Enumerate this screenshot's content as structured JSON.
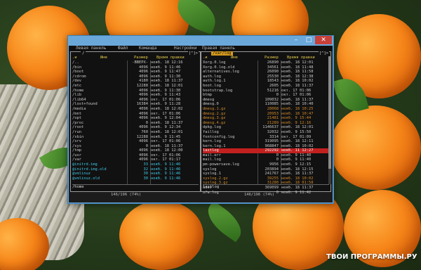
{
  "window": {
    "controls": {
      "minimize": "–",
      "maximize": "□",
      "close": "✕"
    }
  },
  "menubar": {
    "items": [
      "Левая панель",
      "Файл",
      "Команда",
      "Настройки",
      "Правая панель"
    ]
  },
  "left_panel": {
    "path": "/",
    "controls": "[^]>",
    "headers": {
      "name": "Имя",
      "size": "Размер",
      "time": "Время правки"
    },
    "rows": [
      {
        "name": "/..",
        "size": "-ВВЕРХ-",
        "time": "нояб. 18 12:16",
        "type": "dir"
      },
      {
        "name": "/bin",
        "size": "4096",
        "time": "нояб. 9 11:46",
        "type": "dir"
      },
      {
        "name": "/boot",
        "size": "4096",
        "time": "нояб. 9 11:47",
        "type": "dir"
      },
      {
        "name": "/cdrom",
        "size": "4096",
        "time": "нояб. 9 11:30",
        "type": "dir"
      },
      {
        "name": "/dev",
        "size": "4180",
        "time": "нояб. 18 11:37",
        "type": "dir"
      },
      {
        "name": "/etc",
        "size": "12288",
        "time": "нояб. 18 12:01",
        "type": "dir"
      },
      {
        "name": "/home",
        "size": "4096",
        "time": "нояб. 9 11:30",
        "type": "dir"
      },
      {
        "name": "/lib",
        "size": "4096",
        "time": "нояб. 9 11:43",
        "type": "dir"
      },
      {
        "name": "/lib64",
        "size": "4096",
        "time": "окт. 17 01:06",
        "type": "dir"
      },
      {
        "name": "/lost+found",
        "size": "16384",
        "time": "нояб. 9 11:28",
        "type": "dir"
      },
      {
        "name": "/media",
        "size": "4096",
        "time": "нояб. 18 12:02",
        "type": "dir"
      },
      {
        "name": "/mnt",
        "size": "4096",
        "time": "окт. 17 01:06",
        "type": "dir"
      },
      {
        "name": "/opt",
        "size": "4096",
        "time": "нояб. 9 12:04",
        "type": "dir"
      },
      {
        "name": "/proc",
        "size": "0",
        "time": "нояб. 18 11:37",
        "type": "dir"
      },
      {
        "name": "/root",
        "size": "4096",
        "time": "нояб. 9 12:34",
        "type": "dir"
      },
      {
        "name": "/run",
        "size": "760",
        "time": "нояб. 18 12:01",
        "type": "dir"
      },
      {
        "name": "/sbin",
        "size": "12288",
        "time": "нояб. 9 11:45",
        "type": "dir"
      },
      {
        "name": "/srv",
        "size": "4096",
        "time": "окт. 17 01:06",
        "type": "dir"
      },
      {
        "name": "/sys",
        "size": "0",
        "time": "нояб. 18 11:37",
        "type": "dir"
      },
      {
        "name": "/tmp",
        "size": "4096",
        "time": "нояб. 18 12:00",
        "type": "dir"
      },
      {
        "name": "/usr",
        "size": "4096",
        "time": "окт. 17 01:06",
        "type": "dir"
      },
      {
        "name": "/var",
        "size": "4096",
        "time": "окт. 17 01:17",
        "type": "dir"
      },
      {
        "name": "@initrd.img",
        "size": "33",
        "time": "нояб. 9 11:46",
        "type": "link"
      },
      {
        "name": "@initrd.img.old",
        "size": "32",
        "time": "нояб. 9 11:46",
        "type": "link"
      },
      {
        "name": "@vmlinuz",
        "size": "30",
        "time": "нояб. 9 11:46",
        "type": "link"
      },
      {
        "name": "@vmlinuz.old",
        "size": "30",
        "time": "нояб. 9 11:46",
        "type": "link"
      }
    ],
    "status": "/home",
    "position": "146/196 (74%)"
  },
  "right_panel": {
    "path": "/var/log",
    "controls": "[^]>",
    "headers": {
      "name": "Имя",
      "size": "Размер",
      "time": "Время правки"
    },
    "rows": [
      {
        "name": "Xorg.0.log",
        "size": "26890",
        "time": "нояб. 18 12:01",
        "type": "file"
      },
      {
        "name": "Xorg.0.log.old",
        "size": "34561",
        "time": "нояб. 18 11:48",
        "type": "file"
      },
      {
        "name": "alternatives.log",
        "size": "26090",
        "time": "нояб. 18 11:58",
        "type": "file"
      },
      {
        "name": "auth.log",
        "size": "25530",
        "time": "нояб. 18 12:38",
        "type": "file"
      },
      {
        "name": "auth.log.1",
        "size": "18543",
        "time": "нояб. 18 10:02",
        "type": "file"
      },
      {
        "name": "boot.log",
        "size": "2605",
        "time": "нояб. 18 11:37",
        "type": "file"
      },
      {
        "name": "bootstrap.log",
        "size": "51216",
        "time": "окт. 17 01:06",
        "type": "file"
      },
      {
        "name": "btmp",
        "size": "0",
        "time": "окт. 17 01:06",
        "type": "file"
      },
      {
        "name": "dmesg",
        "size": "109032",
        "time": "нояб. 18 11:37",
        "type": "file"
      },
      {
        "name": "dmesg.0",
        "size": "110085",
        "time": "нояб. 18 10:40",
        "type": "file"
      },
      {
        "name": "dmesg.1.gz",
        "size": "28068",
        "time": "нояб. 18 10:25",
        "type": "gz"
      },
      {
        "name": "dmesg.2.gz",
        "size": "20953",
        "time": "нояб. 18 10:47",
        "type": "gz"
      },
      {
        "name": "dmesg.3.gz",
        "size": "21481",
        "time": "нояб. 9 15:44",
        "type": "gz"
      },
      {
        "name": "dmesg.4.gz",
        "size": "21289",
        "time": "нояб. 9 12:16",
        "type": "gz"
      },
      {
        "name": "dpkg.log",
        "size": "1146637",
        "time": "нояб. 18 12:01",
        "type": "file"
      },
      {
        "name": "faillog",
        "size": "32032",
        "time": "нояб. 9 15:50",
        "type": "file"
      },
      {
        "name": "fontconfig.log",
        "size": "3314",
        "time": "окт. 17 01:09",
        "type": "file"
      },
      {
        "name": "kern.log",
        "size": "319095",
        "time": "нояб. 18 12:11",
        "type": "file"
      },
      {
        "name": "kern.log.1",
        "size": "968847",
        "time": "нояб. 18 10:02",
        "type": "file"
      },
      {
        "name": "lastlog",
        "size": "292292",
        "time": "нояб. 11 12:27",
        "type": "selected"
      },
      {
        "name": "mail.err",
        "size": "0",
        "time": "нояб. 9 11:40",
        "type": "file"
      },
      {
        "name": "mail.log",
        "size": "0",
        "time": "нояб. 9 11:40",
        "type": "file"
      },
      {
        "name": "pm-powersave.log",
        "size": "9956",
        "time": "нояб. 9 12:15",
        "type": "file"
      },
      {
        "name": "syslog",
        "size": "203894",
        "time": "нояб. 18 12:15",
        "type": "file"
      },
      {
        "name": "syslog.1",
        "size": "241767",
        "time": "нояб. 18 11:37",
        "type": "file"
      },
      {
        "name": "syslog.2.gz",
        "size": "39255",
        "time": "нояб. 18 10:02",
        "type": "gz"
      },
      {
        "name": "syslog.3.gz",
        "size": "31280",
        "time": "нояб. 18 01:58",
        "type": "gz"
      },
      {
        "name": "udev",
        "size": "369099",
        "time": "нояб. 18 11:37",
        "type": "file"
      },
      {
        "name": "ufw.log",
        "size": "0",
        "time": "нояб. 9 11:42",
        "type": "file"
      }
    ],
    "status": "lastlog",
    "position": "146/196 (74%)"
  },
  "watermark": "ТВОИ ПРОГРАММЫ.РУ"
}
